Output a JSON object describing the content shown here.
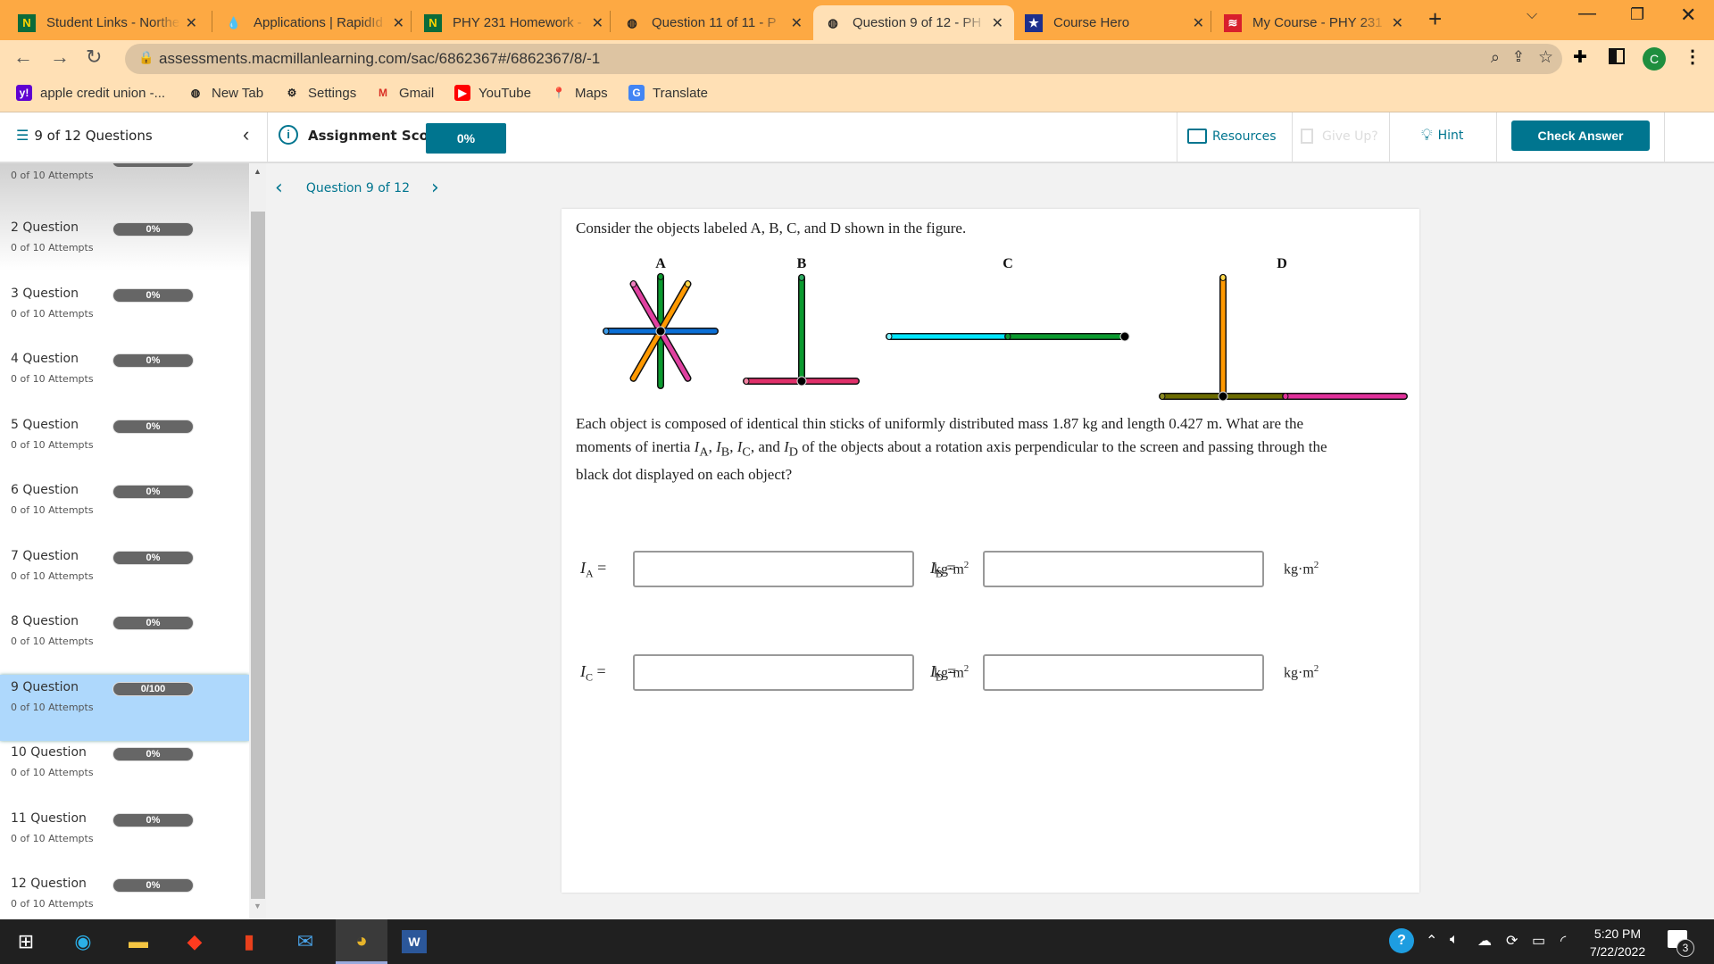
{
  "browser": {
    "tabs": [
      {
        "title": "Student Links - Northe",
        "icon": "northeastern-n-icon",
        "fav": "N",
        "favbg": "#0b6b3a",
        "favfg": "#ffd400"
      },
      {
        "title": "Applications | RapidId",
        "icon": "rapidid-drop-icon",
        "fav": "💧",
        "favbg": "transparent",
        "favfg": "#1e5ad6"
      },
      {
        "title": "PHY 231 Homework - ",
        "icon": "northeastern-n-icon",
        "fav": "N",
        "favbg": "#0b6b3a",
        "favfg": "#ffd400"
      },
      {
        "title": "Question 11 of 11 - P",
        "icon": "globe-icon",
        "fav": "◍",
        "favbg": "transparent",
        "favfg": "#222"
      },
      {
        "title": "Question 9 of 12 - PH",
        "icon": "globe-icon",
        "fav": "◍",
        "favbg": "transparent",
        "favfg": "#222",
        "active": true
      },
      {
        "title": "Course Hero",
        "icon": "course-hero-icon",
        "fav": "★",
        "favbg": "#1d2f8c",
        "favfg": "#fff"
      },
      {
        "title": "My Course - PHY 231",
        "icon": "macmillan-icon",
        "fav": "≋",
        "favbg": "#d81e2c",
        "favfg": "#fff"
      }
    ],
    "new_tab": "+",
    "url": "assessments.macmillanlearning.com/sac/6862367#/6862367/8/-1",
    "profile_initial": "C",
    "bookmarks": [
      {
        "label": "apple credit union -...",
        "icon": "yahoo-icon",
        "glyph": "y!",
        "bg": "#5f01d1",
        "fg": "#fff"
      },
      {
        "label": "New Tab",
        "icon": "globe-icon",
        "glyph": "◍",
        "bg": "transparent",
        "fg": "#222"
      },
      {
        "label": "Settings",
        "icon": "gear-icon",
        "glyph": "⚙",
        "bg": "transparent",
        "fg": "#222"
      },
      {
        "label": "Gmail",
        "icon": "gmail-icon",
        "glyph": "M",
        "bg": "transparent",
        "fg": "#d93025"
      },
      {
        "label": "YouTube",
        "icon": "youtube-icon",
        "glyph": "▶",
        "bg": "#ff0000",
        "fg": "#fff"
      },
      {
        "label": "Maps",
        "icon": "maps-icon",
        "glyph": "📍",
        "bg": "transparent",
        "fg": "#34a853"
      },
      {
        "label": "Translate",
        "icon": "translate-icon",
        "glyph": "G",
        "bg": "#4285f4",
        "fg": "#fff"
      }
    ]
  },
  "header": {
    "questions_label": "9 of 12 Questions",
    "score_label": "Assignment Score:",
    "score_value": "0%",
    "resources": "Resources",
    "give_up": "Give Up?",
    "hint": "Hint",
    "check_answer": "Check Answer",
    "accent": "#00758f"
  },
  "sidebar": {
    "top_partial_attempts": "0 of 10 Attempts",
    "items": [
      {
        "title": "2 Question",
        "score": "0%",
        "attempts": "0 of 10 Attempts"
      },
      {
        "title": "3 Question",
        "score": "0%",
        "attempts": "0 of 10 Attempts"
      },
      {
        "title": "4 Question",
        "score": "0%",
        "attempts": "0 of 10 Attempts"
      },
      {
        "title": "5 Question",
        "score": "0%",
        "attempts": "0 of 10 Attempts"
      },
      {
        "title": "6 Question",
        "score": "0%",
        "attempts": "0 of 10 Attempts"
      },
      {
        "title": "7 Question",
        "score": "0%",
        "attempts": "0 of 10 Attempts"
      },
      {
        "title": "8 Question",
        "score": "0%",
        "attempts": "0 of 10 Attempts"
      },
      {
        "title": "9 Question",
        "score": "0/100",
        "attempts": "0 of 10 Attempts",
        "selected": true
      },
      {
        "title": "10 Question",
        "score": "0%",
        "attempts": "0 of 10 Attempts"
      },
      {
        "title": "11 Question",
        "score": "0%",
        "attempts": "0 of 10 Attempts"
      },
      {
        "title": "12 Question",
        "score": "0%",
        "attempts": "0 of 10 Attempts"
      }
    ]
  },
  "question": {
    "nav_label": "Question 9 of 12",
    "intro": "Consider the objects labeled A, B, C, and D shown in the figure.",
    "figure_labels": [
      "A",
      "B",
      "C",
      "D"
    ],
    "body_line1": "Each object is composed of identical thin sticks of uniformly distributed mass 1.87 kg and length 0.427 m. What are the",
    "body_line2_pre": "moments of inertia ",
    "body_line2_post": " of the objects about a rotation axis perpendicular to the screen and passing through the",
    "body_line3": "black dot displayed on each object?",
    "answers": [
      {
        "symbol": "I",
        "sub": "A",
        "value": "",
        "unit": "kg·m",
        "exp": "2"
      },
      {
        "symbol": "I",
        "sub": "B",
        "value": "",
        "unit": "kg·m",
        "exp": "2"
      },
      {
        "symbol": "I",
        "sub": "C",
        "value": "",
        "unit": "kg·m",
        "exp": "2"
      },
      {
        "symbol": "I",
        "sub": "D",
        "value": "",
        "unit": "kg·m",
        "exp": "2"
      }
    ]
  },
  "taskbar": {
    "time": "5:20 PM",
    "date": "7/22/2022",
    "notifications": "3"
  }
}
